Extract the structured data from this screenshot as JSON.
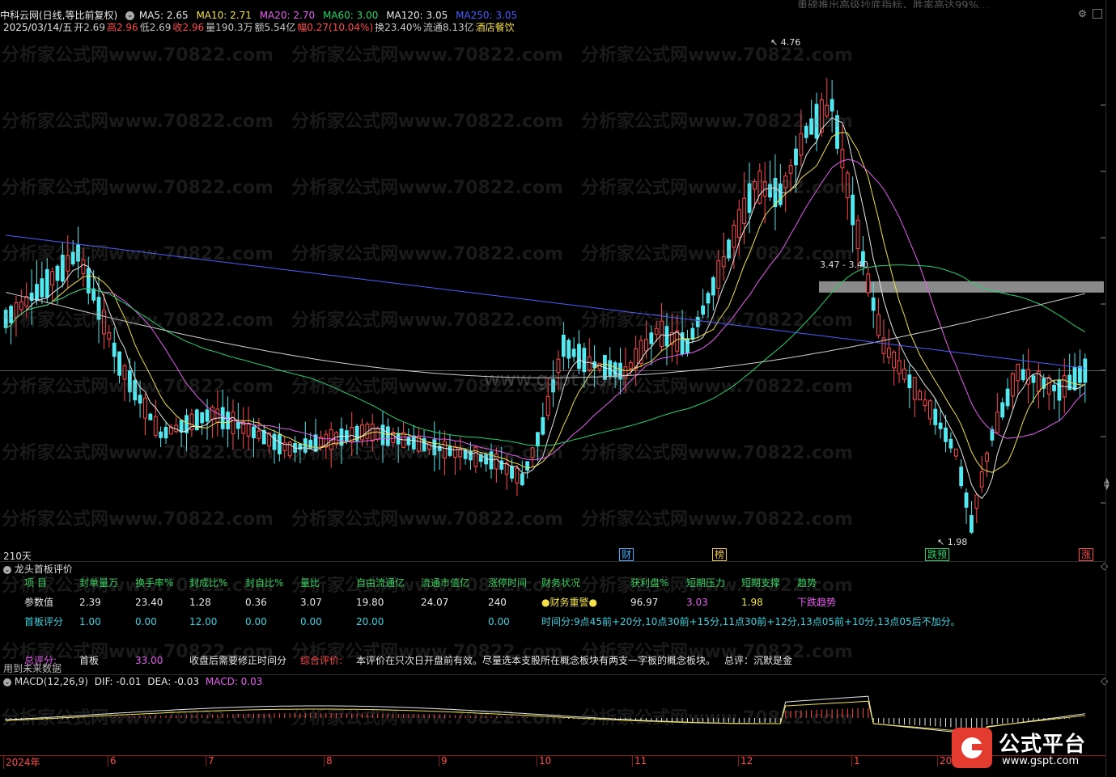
{
  "header": {
    "title": "中科云网(日线,等比前复权)",
    "ma": [
      {
        "label": "MA5: 2.65",
        "color": "#e8e8e8"
      },
      {
        "label": "MA10: 2.71",
        "color": "#f2e14a"
      },
      {
        "label": "MA20: 2.70",
        "color": "#e65ff0"
      },
      {
        "label": "MA60: 3.00",
        "color": "#25d46a"
      },
      {
        "label": "MA120: 3.05",
        "color": "#e8e8e8"
      },
      {
        "label": "MA250: 3.05",
        "color": "#4c5cff"
      }
    ],
    "line2": {
      "date": "2025/03/14/五",
      "open_label": "开",
      "open": "2.69",
      "high_label": "高",
      "high": "2.96",
      "low_label": "低",
      "low": "2.69",
      "close_label": "收",
      "close": "2.96",
      "vol_label": "量",
      "vol": "190.3万",
      "amount_label": "额",
      "amount": "5.54亿",
      "change_label": "幅",
      "change": "0.27(10.04%)",
      "turnover_label": "换",
      "turnover": "23.40%",
      "float_label": "流通",
      "float": "8.13亿",
      "sector": "酒店餐饮"
    },
    "top_banner": "重磅推出高级抄底指标，胜率高达99%…"
  },
  "chart_data": {
    "type": "candlestick",
    "title": "",
    "price_labels": {
      "high": "4.76",
      "low": "1.98",
      "mid_left": "3.47",
      "mid_right": "3.40"
    },
    "ylim": [
      1.9,
      4.85
    ],
    "period_label": "210天",
    "event_tags": [
      {
        "label": "财",
        "color": "#3fb0ff"
      },
      {
        "label": "榜",
        "color": "#f2c94a"
      },
      {
        "label": "跌预",
        "color": "#25d46a"
      },
      {
        "label": "涨",
        "color": "#ff4a4a"
      }
    ],
    "x_labels": [
      "2024年",
      "6",
      "7",
      "8",
      "9",
      "10",
      "11",
      "12",
      "1",
      "20"
    ],
    "ma_series": [
      {
        "name": "MA5",
        "color": "#e8e8e8"
      },
      {
        "name": "MA10",
        "color": "#f2e14a"
      },
      {
        "name": "MA20",
        "color": "#e65ff0"
      },
      {
        "name": "MA60",
        "color": "#25d46a"
      },
      {
        "name": "MA120",
        "color": "#d0d0d0"
      },
      {
        "name": "MA250",
        "color": "#4c5cff"
      }
    ]
  },
  "watermark": {
    "text": "分析家公式网www.70822.com",
    "center": "www.gspt.com"
  },
  "indicator": {
    "title": "龙头首板评价",
    "headers": [
      "项 目",
      "封单量万",
      "换手率%",
      "封成比%",
      "封自比%",
      "量比",
      "自由流通亿",
      "流通市值亿",
      "涨停时间",
      "财务状况",
      "获利盘%",
      "短期压力",
      "短期支撑",
      "趋势"
    ],
    "values_label": "参数值",
    "values": [
      "2.39",
      "23.40",
      "1.28",
      "0.36",
      "3.07",
      "19.80",
      "24.07",
      "240",
      "●财务重警●",
      "96.97",
      "3.03",
      "1.98",
      "下跌趋势"
    ],
    "score_label": "首板评分",
    "scores": [
      "1.00",
      "0.00",
      "12.00",
      "0.00",
      "0.00",
      "20.00",
      "",
      "0.00"
    ],
    "time_note": "时间分:9点45前+20分,10点30前+15分,11点30前+12分,13点05前+10分,13点05后不加分。",
    "total_label": "总评分:",
    "total_type": "首板",
    "total_score": "33.00",
    "total_note": "收盘后需要修正时间分",
    "eval_label": "综合评价:",
    "eval_text": "本评价在只次日开盘前有效。尽量选本支股所在概念板块有两支一字板的概念板块。",
    "summary": "总评：沉默是金",
    "future_note": "用到未来数据"
  },
  "macd": {
    "title": "MACD(12,26,9)",
    "dif": "DIF: -0.01",
    "dea": "DEA: -0.03",
    "macd": "MACD: 0.03"
  },
  "logo": {
    "brand": "公式平台",
    "url": "www.gspt.com"
  }
}
